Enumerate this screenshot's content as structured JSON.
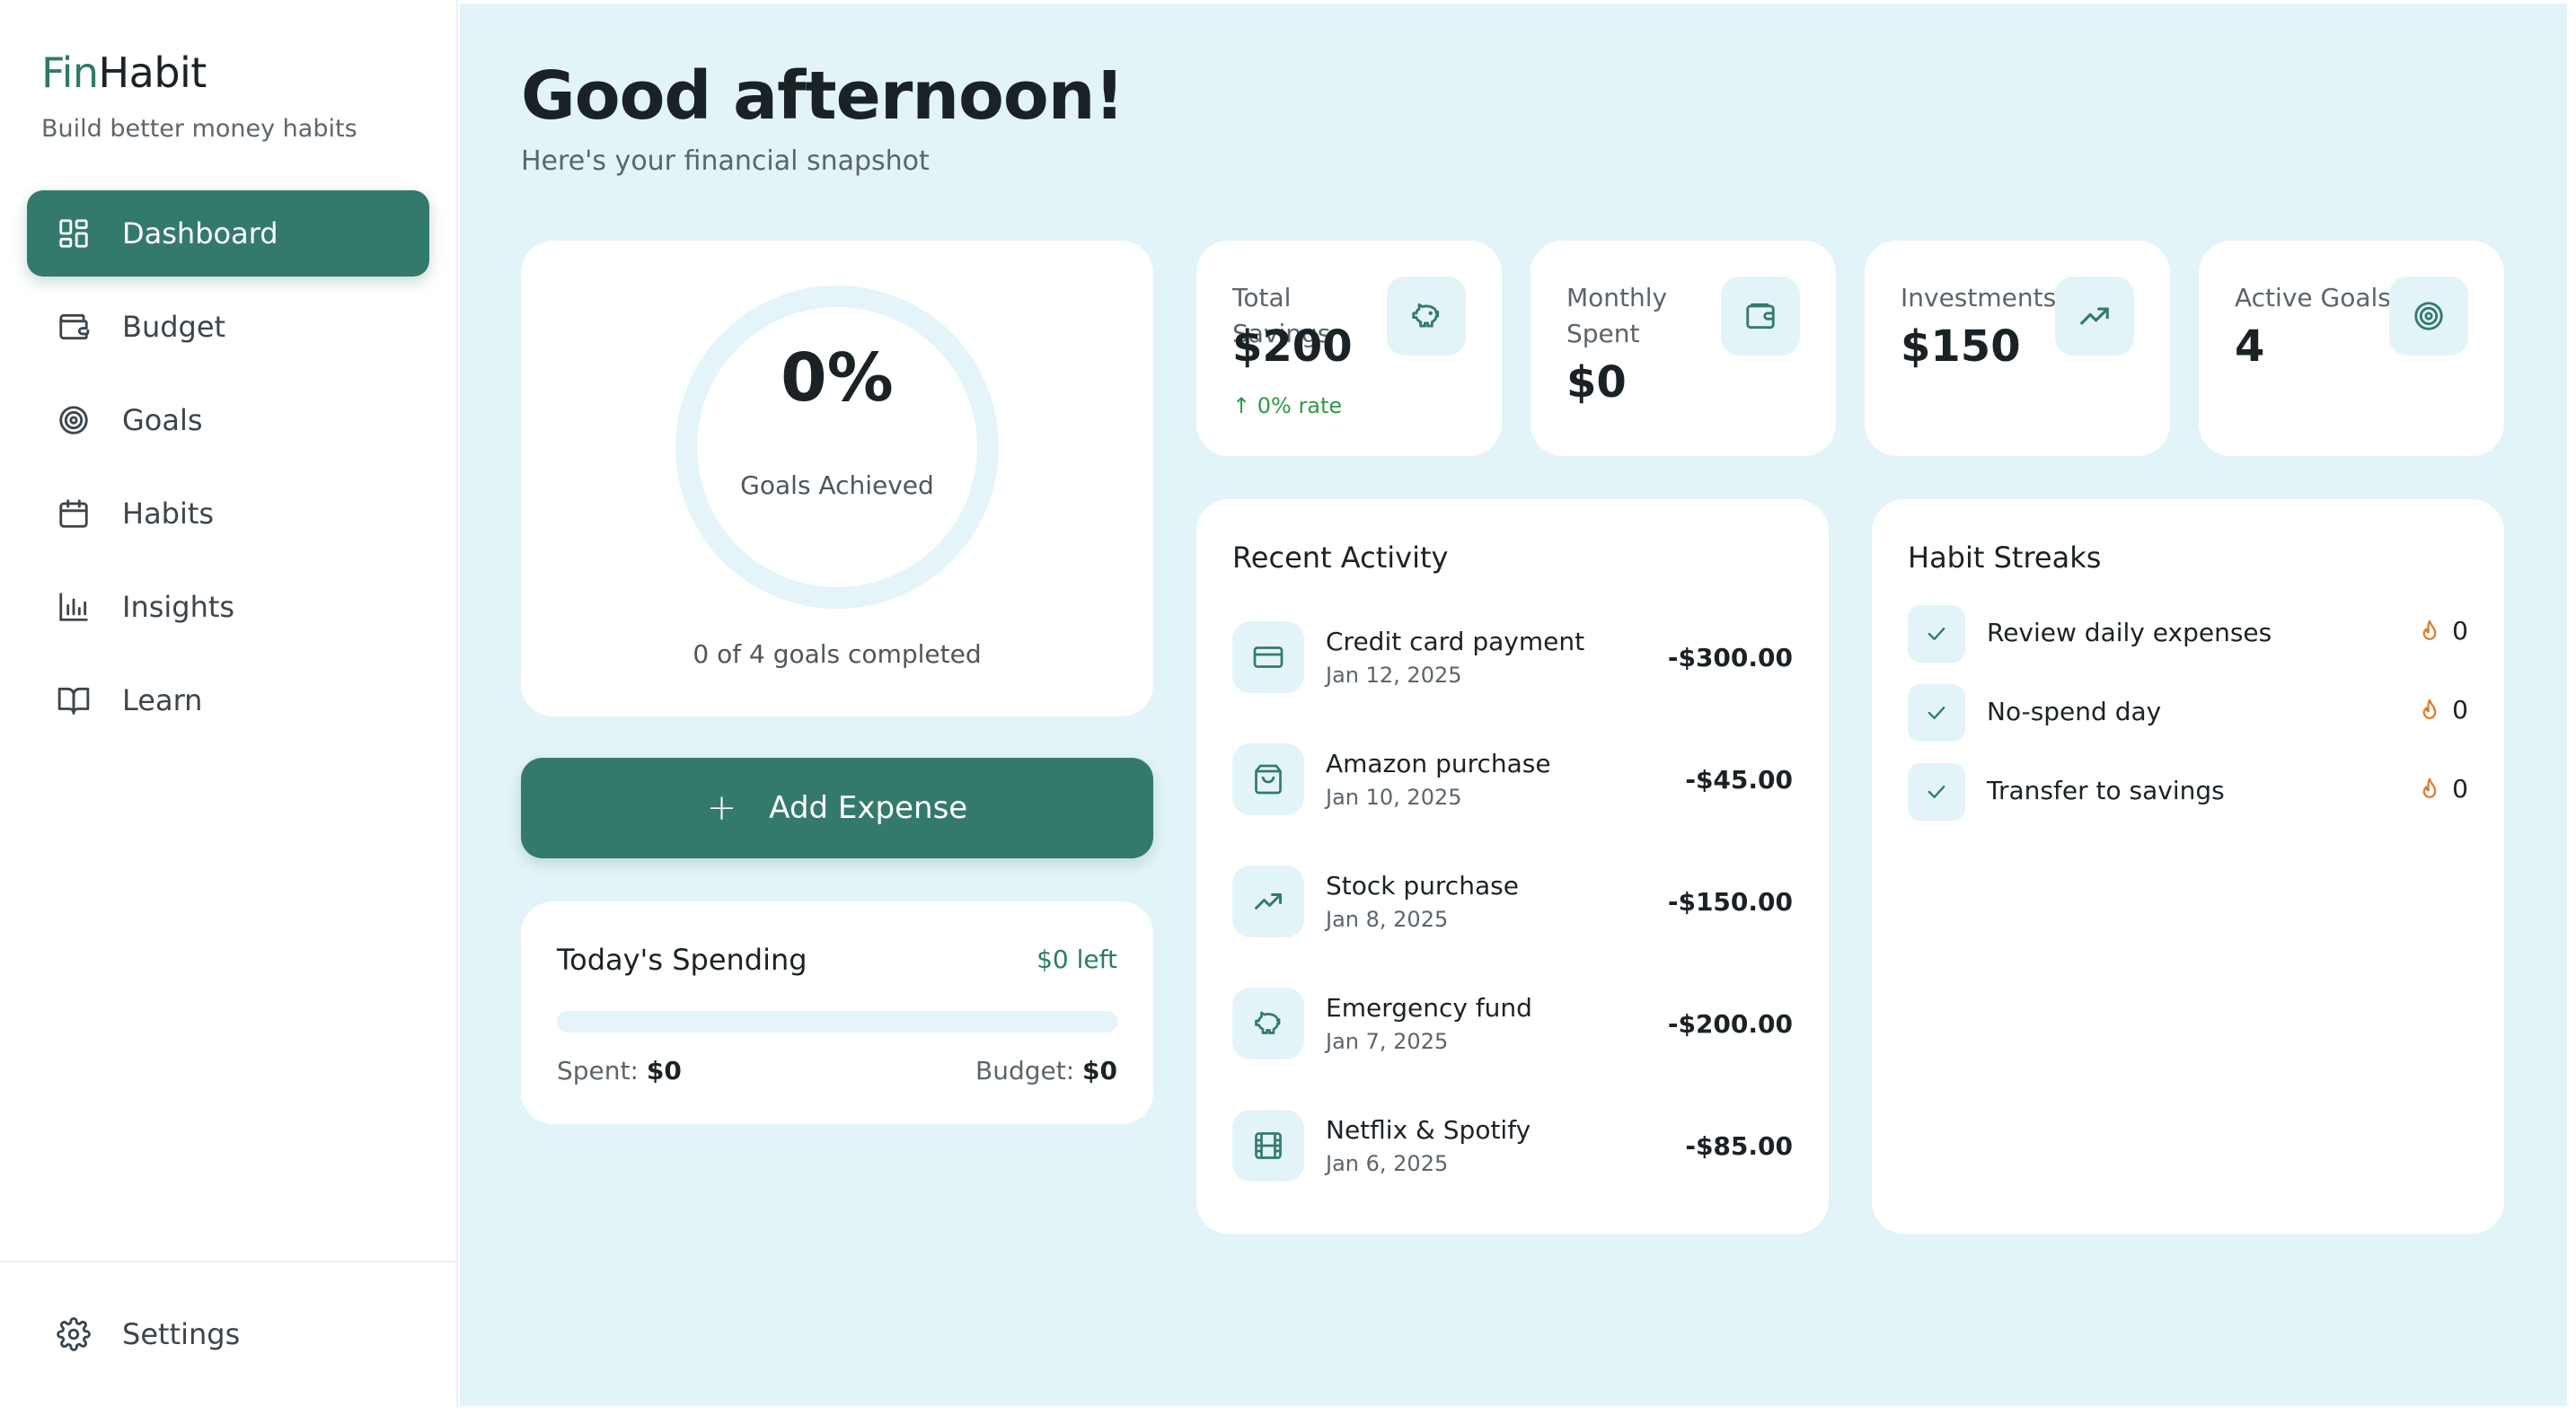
{
  "brand": {
    "part1": "Fin",
    "part2": "Habit",
    "tagline": "Build better money habits"
  },
  "nav": {
    "items": [
      {
        "label": "Dashboard",
        "icon": "dashboard-icon",
        "active": true
      },
      {
        "label": "Budget",
        "icon": "wallet-icon",
        "active": false
      },
      {
        "label": "Goals",
        "icon": "target-icon",
        "active": false
      },
      {
        "label": "Habits",
        "icon": "calendar-icon",
        "active": false
      },
      {
        "label": "Insights",
        "icon": "bar-chart-icon",
        "active": false
      },
      {
        "label": "Learn",
        "icon": "book-icon",
        "active": false
      }
    ],
    "settings_label": "Settings"
  },
  "header": {
    "title": "Good afternoon!",
    "subtitle": "Here's your financial snapshot"
  },
  "goals": {
    "percent": "0%",
    "label": "Goals Achieved",
    "progress": 0,
    "summary": "0 of 4 goals completed"
  },
  "actions": {
    "add_expense": "Add Expense"
  },
  "spending": {
    "title": "Today's Spending",
    "left_text": "$0 left",
    "progress": 0,
    "spent_label": "Spent:",
    "spent_value": "$0",
    "budget_label": "Budget:",
    "budget_value": "$0"
  },
  "stats": [
    {
      "label": "Total Savings",
      "value": "$200",
      "note": "↑ 0% rate",
      "icon": "piggy-bank-icon"
    },
    {
      "label": "Monthly Spent",
      "value": "$0",
      "note": "",
      "icon": "wallet-icon"
    },
    {
      "label": "Investments",
      "value": "$150",
      "note": "",
      "icon": "trending-up-icon"
    },
    {
      "label": "Active Goals",
      "value": "4",
      "note": "",
      "icon": "target-icon"
    }
  ],
  "activity": {
    "title": "Recent Activity",
    "items": [
      {
        "name": "Credit card payment",
        "date": "Jan 12, 2025",
        "amount": "-$300.00",
        "icon": "credit-card-icon"
      },
      {
        "name": "Amazon purchase",
        "date": "Jan 10, 2025",
        "amount": "-$45.00",
        "icon": "shopping-bag-icon"
      },
      {
        "name": "Stock purchase",
        "date": "Jan 8, 2025",
        "amount": "-$150.00",
        "icon": "trending-up-icon"
      },
      {
        "name": "Emergency fund",
        "date": "Jan 7, 2025",
        "amount": "-$200.00",
        "icon": "piggy-bank-icon"
      },
      {
        "name": "Netflix & Spotify",
        "date": "Jan 6, 2025",
        "amount": "-$85.00",
        "icon": "film-icon"
      }
    ]
  },
  "habits": {
    "title": "Habit Streaks",
    "items": [
      {
        "name": "Review daily expenses",
        "streak": "0"
      },
      {
        "name": "No-spend day",
        "streak": "0"
      },
      {
        "name": "Transfer to savings",
        "streak": "0"
      }
    ]
  },
  "colors": {
    "accent": "#347a6c",
    "background": "#e3f4f8",
    "positive": "#2e9a48",
    "flame": "#e07b2c"
  }
}
